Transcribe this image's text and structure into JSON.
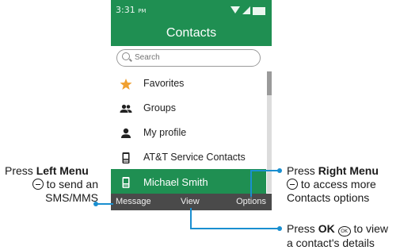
{
  "status": {
    "time": "3:31",
    "ampm": "PM"
  },
  "header": {
    "title": "Contacts"
  },
  "search": {
    "placeholder": "Search"
  },
  "list": [
    {
      "label": "Favorites",
      "icon": "star-icon"
    },
    {
      "label": "Groups",
      "icon": "groups-icon"
    },
    {
      "label": "My profile",
      "icon": "person-icon"
    },
    {
      "label": "AT&T Service Contacts",
      "icon": "phone-icon"
    },
    {
      "label": "Michael Smith",
      "icon": "phone-icon"
    }
  ],
  "softkeys": {
    "left": "Message",
    "center": "View",
    "right": "Options"
  },
  "annotations": {
    "left": {
      "press": "Press",
      "key": "Left Menu",
      "line2": "to send an",
      "line3": "SMS/MMS"
    },
    "right": {
      "press": "Press",
      "key": "Right Menu",
      "line2": "to access more",
      "line3": "Contacts options"
    },
    "ok": {
      "press": "Press",
      "key": "OK",
      "line1_end": "to view",
      "line2": "a contact's details",
      "ok_glyph": "OK"
    }
  },
  "colors": {
    "accent": "#1f8f52",
    "softkey_bar": "#4a4a4a",
    "callout_line": "#1a8fd0",
    "star": "#f0a030"
  }
}
